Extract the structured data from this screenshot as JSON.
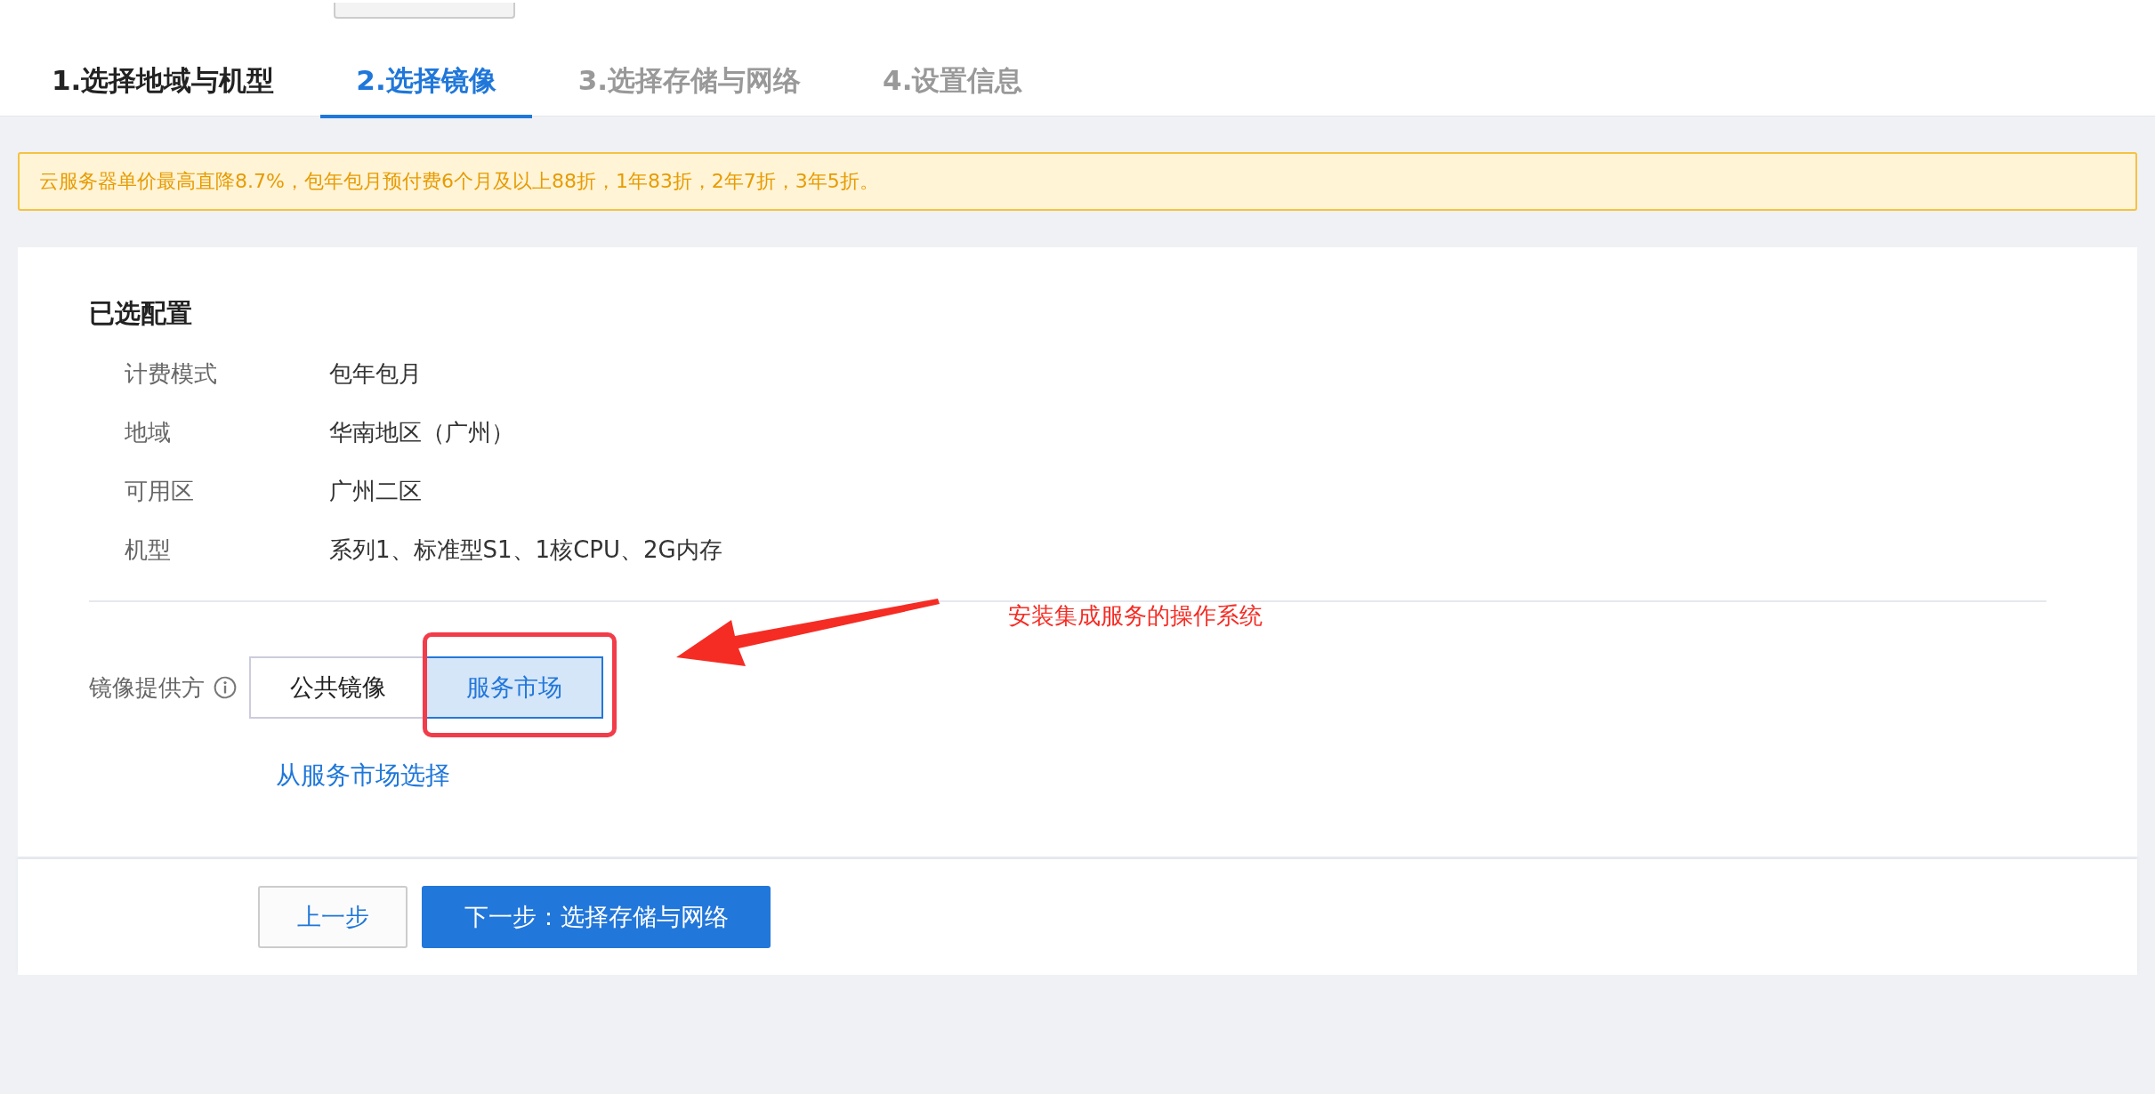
{
  "tabs": [
    {
      "label": "1.选择地域与机型",
      "selected": false,
      "completed": true
    },
    {
      "label": "2.选择镜像",
      "selected": true,
      "completed": false
    },
    {
      "label": "3.选择存储与网络",
      "selected": false,
      "completed": false
    },
    {
      "label": "4.设置信息",
      "selected": false,
      "completed": false
    }
  ],
  "notice": "云服务器单价最高直降8.7%，包年包月预付费6个月及以上88折，1年83折，2年7折，3年5折。",
  "summary": {
    "title": "已选配置",
    "rows": [
      {
        "label": "计费模式",
        "value": "包年包月"
      },
      {
        "label": "地域",
        "value": "华南地区（广州）"
      },
      {
        "label": "可用区",
        "value": "广州二区"
      },
      {
        "label": "机型",
        "value": "系列1、标准型S1、1核CPU、2G内存"
      }
    ]
  },
  "provider": {
    "label": "镜像提供方",
    "options": [
      {
        "label": "公共镜像",
        "selected": false
      },
      {
        "label": "服务市场",
        "selected": true
      }
    ],
    "link": "从服务市场选择"
  },
  "annotation": {
    "text": "安装集成服务的操作系统"
  },
  "buttons": [
    {
      "label": "上一步",
      "kind": "secondary"
    },
    {
      "label": "下一步：选择存储与网络",
      "kind": "primary"
    }
  ]
}
